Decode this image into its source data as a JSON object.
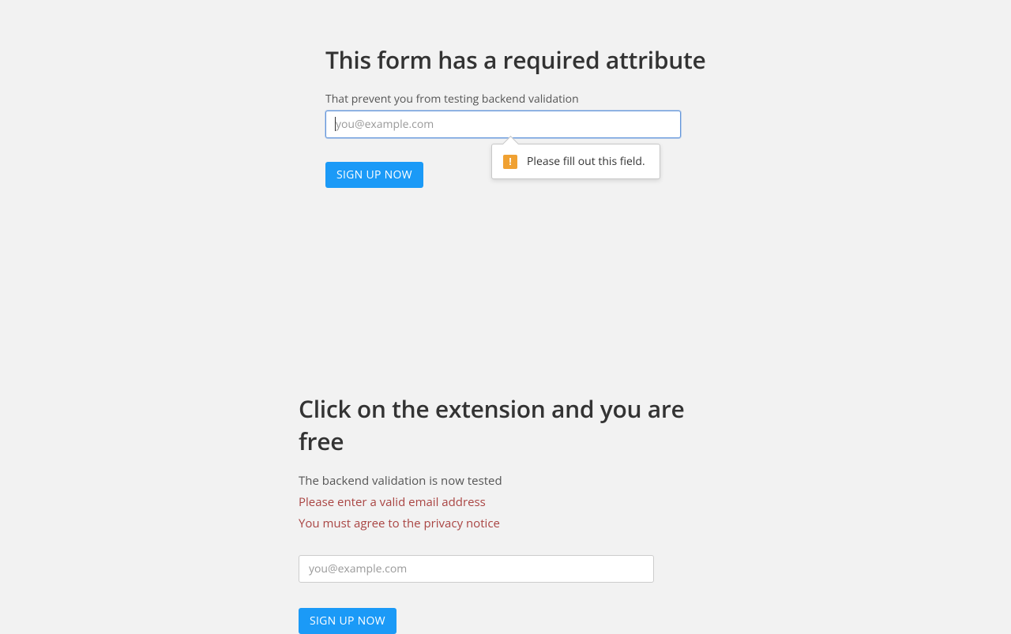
{
  "section1": {
    "heading": "This form has a required attribute",
    "subtitle": "That prevent you from testing backend validation",
    "email_placeholder": "you@example.com",
    "button_label": "SIGN UP NOW",
    "tooltip": {
      "icon_glyph": "!",
      "message": "Please fill out this field."
    }
  },
  "section2": {
    "heading": "Click on the extension and you are free",
    "subtitle": "The backend validation is now tested",
    "errors": [
      "Please enter a valid email address",
      "You must agree to the privacy notice"
    ],
    "email_placeholder": "you@example.com",
    "button_label": "SIGN UP NOW"
  }
}
